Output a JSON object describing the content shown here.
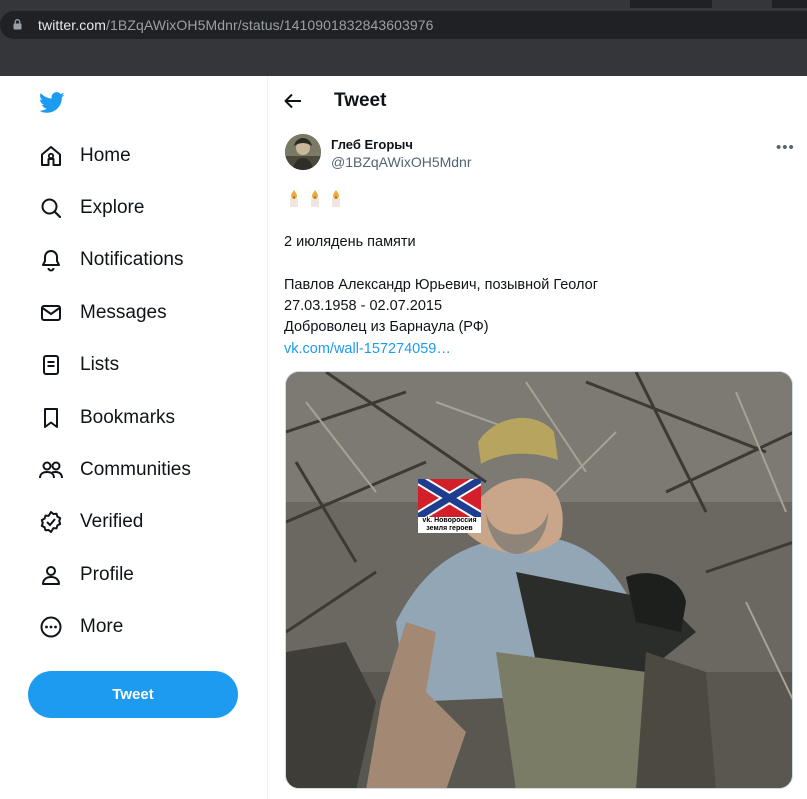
{
  "browser": {
    "url_host": "twitter.com",
    "url_path": "/1BZqAWixOH5Mdnr/status/1410901832843603976"
  },
  "sidebar": {
    "logo_icon": "twitter-bird-icon",
    "items": [
      {
        "label": "Home",
        "icon": "home-icon"
      },
      {
        "label": "Explore",
        "icon": "search-icon"
      },
      {
        "label": "Notifications",
        "icon": "bell-icon"
      },
      {
        "label": "Messages",
        "icon": "envelope-icon"
      },
      {
        "label": "Lists",
        "icon": "list-icon"
      },
      {
        "label": "Bookmarks",
        "icon": "bookmark-icon"
      },
      {
        "label": "Communities",
        "icon": "people-icon"
      },
      {
        "label": "Verified",
        "icon": "verified-badge-icon"
      },
      {
        "label": "Profile",
        "icon": "person-icon"
      },
      {
        "label": "More",
        "icon": "more-circle-icon"
      }
    ],
    "tweet_button": "Tweet"
  },
  "main": {
    "header_title": "Tweet",
    "author": {
      "display_name": "Глеб Егорыч",
      "handle": "@1BZqAWixOH5Mdnr"
    },
    "candles": "🕯️🕯️🕯️",
    "text_lines": [
      "2 июлядень памяти",
      "Павлов Александр Юрьевич, позывной Геолог",
      "27.03.1958 - 02.07.2015",
      "Доброволец из Барнаула (РФ)"
    ],
    "link": "vk.com/wall-157274059…",
    "image_overlay": {
      "caption_line1": "vk. Новороссия",
      "caption_line2": "земля героев"
    }
  },
  "colors": {
    "accent": "#1d9bf0",
    "text": "#0f1419",
    "muted": "#536471",
    "chrome": "#35363a"
  }
}
